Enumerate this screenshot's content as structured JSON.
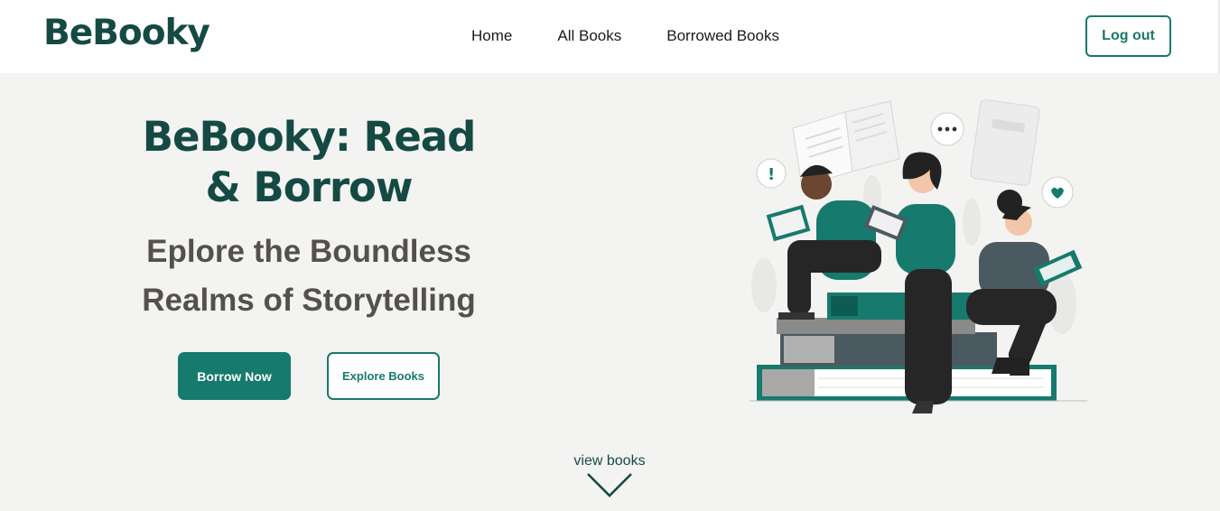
{
  "brand": {
    "name": "BeBooky"
  },
  "nav": {
    "items": [
      {
        "label": "Home"
      },
      {
        "label": "All Books"
      },
      {
        "label": "Borrowed Books"
      }
    ],
    "logout_label": "Log out"
  },
  "hero": {
    "title": "BeBooky: Read & Borrow",
    "subtitle": "Eplore the Boundless Realms of Storytelling",
    "primary_button": "Borrow Now",
    "secondary_button": "Explore Books",
    "illustration_icon": "people-reading-books-illustration"
  },
  "scroll_hint": {
    "label": "view books",
    "icon": "chevron-down-icon"
  },
  "colors": {
    "brand": "#154a44",
    "accent": "#167a6c",
    "subtitle": "#555050",
    "background": "#f3f3f1"
  }
}
